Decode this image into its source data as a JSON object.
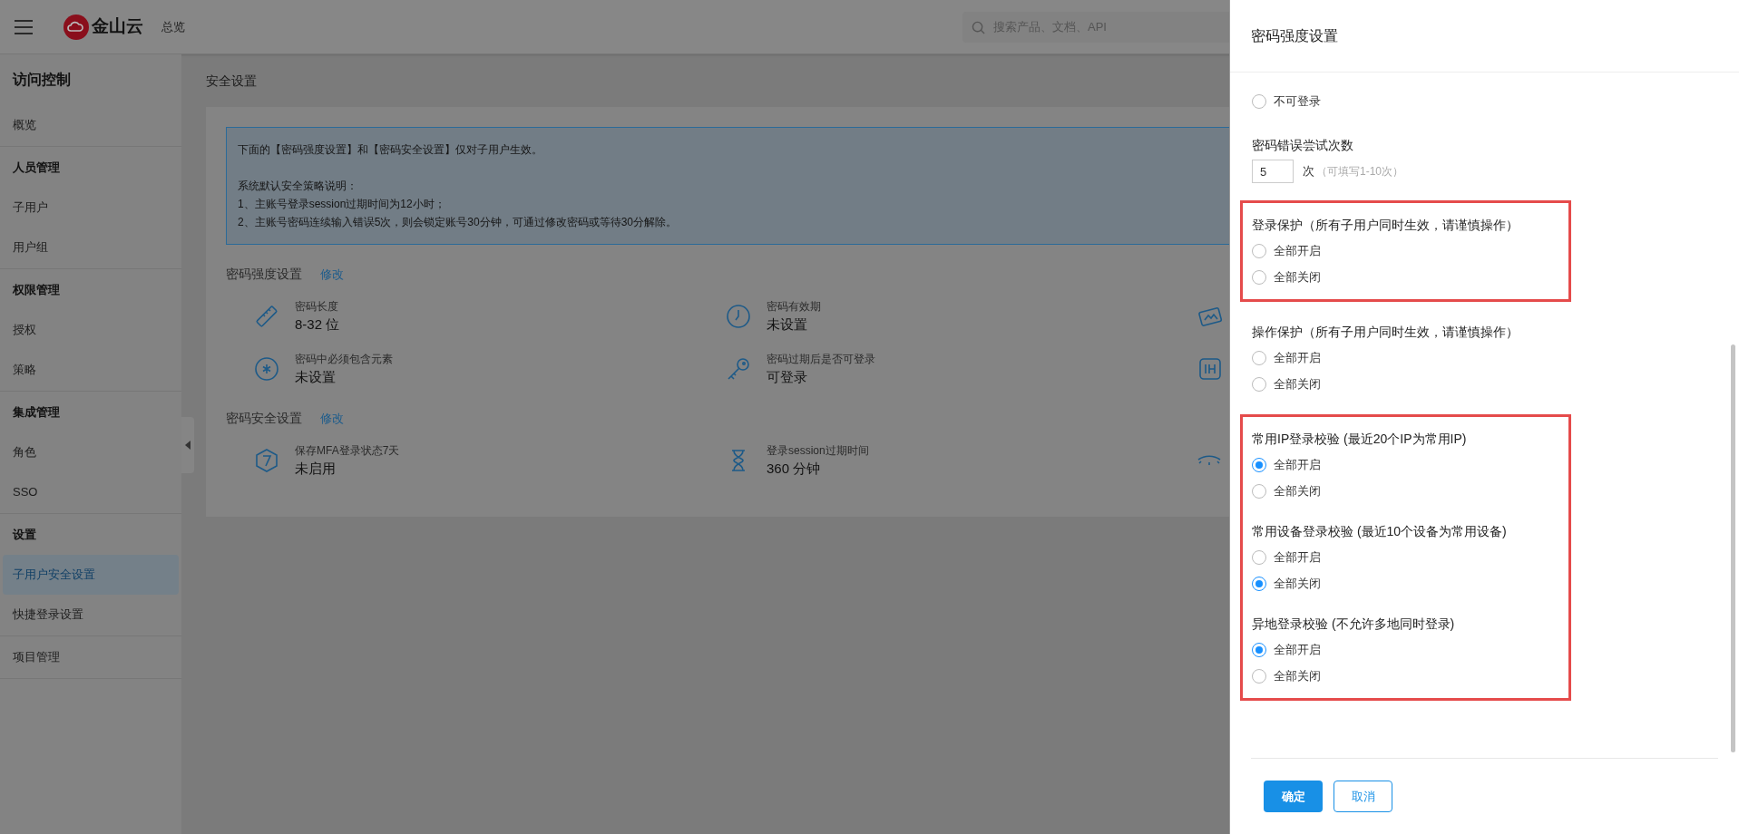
{
  "header": {
    "logo_text": "金山云",
    "nav_link": "总览",
    "search": {
      "placeholder": "搜索产品、文档、API"
    }
  },
  "sidebar": {
    "title": "访问控制",
    "groups": [
      {
        "items": [
          {
            "label": "概览",
            "selected": false
          }
        ]
      },
      {
        "heading": "人员管理",
        "items": [
          {
            "label": "子用户",
            "selected": false
          },
          {
            "label": "用户组",
            "selected": false
          }
        ]
      },
      {
        "heading": "权限管理",
        "items": [
          {
            "label": "授权",
            "selected": false
          },
          {
            "label": "策略",
            "selected": false
          }
        ]
      },
      {
        "heading": "集成管理",
        "items": [
          {
            "label": "角色",
            "selected": false
          },
          {
            "label": "SSO",
            "selected": false
          }
        ]
      },
      {
        "heading": "设置",
        "items": [
          {
            "label": "子用户安全设置",
            "selected": true
          },
          {
            "label": "快捷登录设置",
            "selected": false
          }
        ]
      },
      {
        "items": [
          {
            "label": "项目管理",
            "selected": false
          }
        ]
      }
    ]
  },
  "page_title": "安全设置",
  "notice": {
    "intro": "下面的【密码强度设置】和【密码安全设置】仅对子用户生效。",
    "lines": [
      "系统默认安全策略说明：",
      "1、主账号登录session过期时间为12小时；",
      "2、主账号密码连续输入错误5次，则会锁定账号30分钟，可通过修改密码或等待30分解除。"
    ]
  },
  "sections": [
    {
      "title": "密码强度设置",
      "edit_link": "修改",
      "items": [
        {
          "label": "密码长度",
          "value": "8-32 位"
        },
        {
          "label": "密码有效期",
          "value": "未设置"
        },
        {
          "label": "密码中必须包含元素",
          "value": "未设置"
        },
        {
          "label": "密码过期后是否可登录",
          "value": "可登录"
        }
      ]
    },
    {
      "title": "密码安全设置",
      "edit_link": "修改",
      "items": [
        {
          "label": "保存MFA登录状态7天",
          "value": "未启用"
        },
        {
          "label": "登录session过期时间",
          "value": "360 分钟"
        }
      ]
    }
  ],
  "drawer": {
    "title": "密码强度设置",
    "blocks": [
      {
        "highlighted": false,
        "items": [
          {
            "kind": "radio",
            "options": [
              {
                "label": "不可登录",
                "selected": false
              }
            ]
          },
          {
            "kind": "number",
            "title": "密码错误尝试次数",
            "value": "5",
            "unit": "次",
            "hint": "（可填写1-10次）"
          }
        ]
      },
      {
        "highlighted": true,
        "items": [
          {
            "kind": "radio",
            "title": "登录保护（所有子用户同时生效，请谨慎操作）",
            "options": [
              {
                "label": "全部开启",
                "selected": false
              },
              {
                "label": "全部关闭",
                "selected": false
              }
            ]
          }
        ]
      },
      {
        "highlighted": false,
        "items": [
          {
            "kind": "radio",
            "title": "操作保护（所有子用户同时生效，请谨慎操作）",
            "options": [
              {
                "label": "全部开启",
                "selected": false
              },
              {
                "label": "全部关闭",
                "selected": false
              }
            ]
          }
        ]
      },
      {
        "highlighted": true,
        "items": [
          {
            "kind": "radio",
            "title": "常用IP登录校验 (最近20个IP为常用IP)",
            "options": [
              {
                "label": "全部开启",
                "selected": true
              },
              {
                "label": "全部关闭",
                "selected": false
              }
            ]
          },
          {
            "kind": "radio",
            "title": "常用设备登录校验 (最近10个设备为常用设备)",
            "options": [
              {
                "label": "全部开启",
                "selected": false
              },
              {
                "label": "全部关闭",
                "selected": true
              }
            ]
          },
          {
            "kind": "radio",
            "title": "异地登录校验 (不允许多地同时登录)",
            "options": [
              {
                "label": "全部开启",
                "selected": true
              },
              {
                "label": "全部关闭",
                "selected": false
              }
            ]
          }
        ]
      }
    ],
    "buttons": [
      {
        "label": "确定",
        "kind": "primary"
      },
      {
        "label": "取消",
        "kind": "secondary"
      }
    ]
  }
}
